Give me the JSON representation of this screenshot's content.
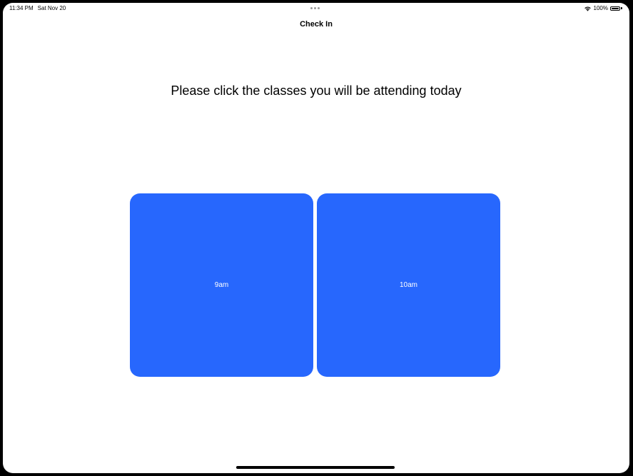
{
  "status_bar": {
    "time": "11:34 PM",
    "date": "Sat Nov 20",
    "wifi_icon": "wifi-icon",
    "battery_percent_label": "100%",
    "battery_level": 1.0,
    "battery_icon": "battery-full-icon"
  },
  "nav": {
    "title": "Check In"
  },
  "main": {
    "prompt": "Please click the classes you will be attending today",
    "classes": [
      {
        "label": "9am"
      },
      {
        "label": "10am"
      }
    ]
  },
  "colors": {
    "class_button": "#2767fd",
    "background": "#ffffff",
    "bezel": "#000000"
  }
}
